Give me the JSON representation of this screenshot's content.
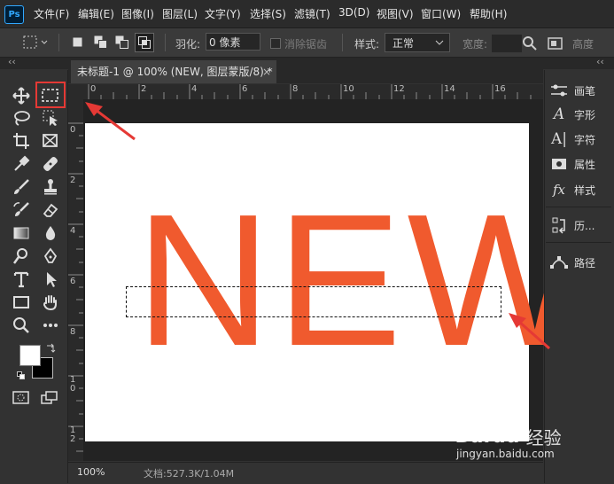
{
  "app": {
    "logo_text": "Ps",
    "accent": "#31a8ff"
  },
  "menu": [
    "文件(F)",
    "编辑(E)",
    "图像(I)",
    "图层(L)",
    "文字(Y)",
    "选择(S)",
    "滤镜(T)",
    "3D(D)",
    "视图(V)",
    "窗口(W)",
    "帮助(H)"
  ],
  "options_bar": {
    "feather_label": "羽化:",
    "feather_value": "0 像素",
    "antialias_label": "消除锯齿",
    "style_label": "样式:",
    "style_value": "正常",
    "width_label": "宽度:",
    "height_label": "高度"
  },
  "document": {
    "tab_title": "未标题-1 @ 100% (NEW, 图层蒙版/8) *",
    "close_glyph": "×",
    "canvas_text": "NEW",
    "text_color": "#f05a2e",
    "ruler_h": [
      "0",
      "2",
      "4",
      "6",
      "8",
      "10",
      "12",
      "14",
      "16"
    ],
    "ruler_v": [
      "0",
      "2",
      "4",
      "6",
      "8",
      "1\n0",
      "1\n2"
    ]
  },
  "status": {
    "zoom": "100%",
    "doc_info": "文档:527.3K/1.04M"
  },
  "panels": [
    {
      "icon": "brush-settings-icon",
      "label": "画笔"
    },
    {
      "icon": "character-icon",
      "label": "字形"
    },
    {
      "icon": "paragraph-char-icon",
      "label": "字符"
    },
    {
      "icon": "properties-icon",
      "label": "属性"
    },
    {
      "icon": "styles-fx-icon",
      "label": "样式"
    },
    {
      "icon": "history-icon",
      "label": "历..."
    },
    {
      "icon": "paths-icon",
      "label": "路径"
    }
  ],
  "collapse_glyph": "‹‹",
  "watermark": {
    "brand": "Bai",
    "paw": "du",
    "cn": "经验",
    "url": "jingyan.baidu.com"
  }
}
